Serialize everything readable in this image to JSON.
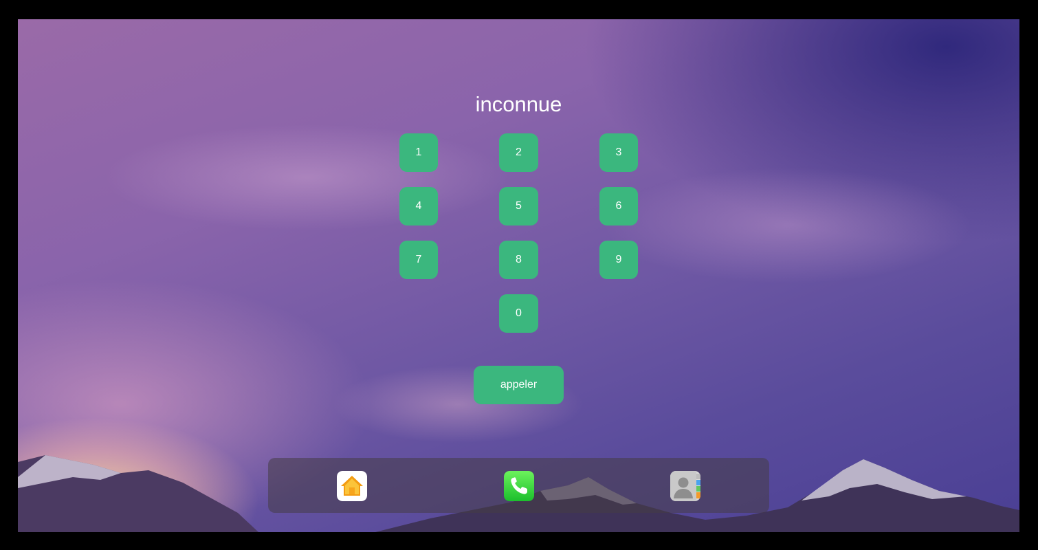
{
  "header": {
    "title": "inconnue"
  },
  "keypad": {
    "keys": [
      "1",
      "2",
      "3",
      "4",
      "5",
      "6",
      "7",
      "8",
      "9",
      "0"
    ],
    "call_label": "appeler",
    "accent_color": "#3bb77e"
  },
  "dock": {
    "apps": [
      {
        "name": "home",
        "icon": "home-icon"
      },
      {
        "name": "phone",
        "icon": "phone-icon"
      },
      {
        "name": "contacts",
        "icon": "contacts-icon"
      }
    ]
  }
}
